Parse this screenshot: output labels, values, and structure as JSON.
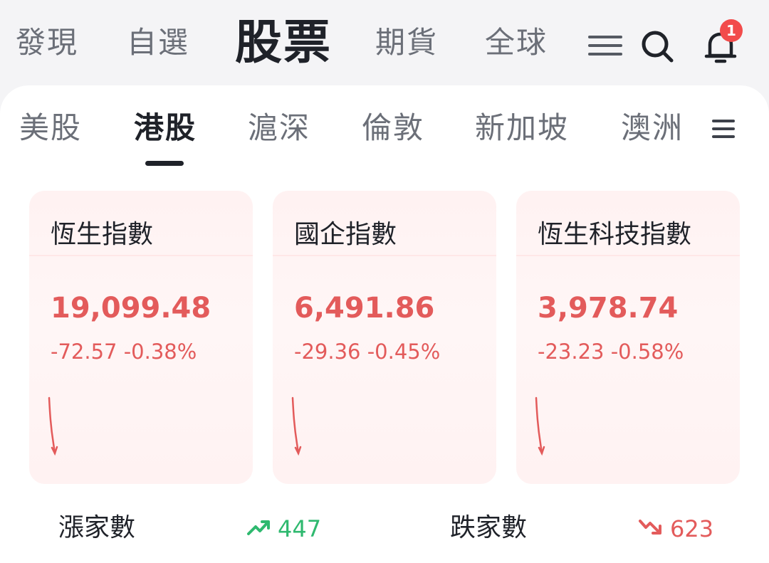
{
  "top_tabs": {
    "discover": "發現",
    "watchlist": "自選",
    "stocks": "股票",
    "futures": "期貨",
    "global": "全球"
  },
  "notification_badge": "1",
  "sub_tabs": {
    "us": "美股",
    "hk": "港股",
    "a_share": "滬深",
    "london": "倫敦",
    "singapore": "新加坡",
    "australia": "澳洲"
  },
  "indices": [
    {
      "name": "恆生指數",
      "price": "19,099.48",
      "change": "-72.57 -0.38%"
    },
    {
      "name": "國企指數",
      "price": "6,491.86",
      "change": "-29.36 -0.45%"
    },
    {
      "name": "恆生科技指數",
      "price": "3,978.74",
      "change": "-23.23 -0.58%"
    }
  ],
  "breadth": {
    "up_label": "漲家數",
    "up_count": "447",
    "down_label": "跌家數",
    "down_count": "623"
  },
  "colors": {
    "down_red": "#e35b5b",
    "up_green": "#2fb96f",
    "badge_red": "#f24b4b"
  }
}
